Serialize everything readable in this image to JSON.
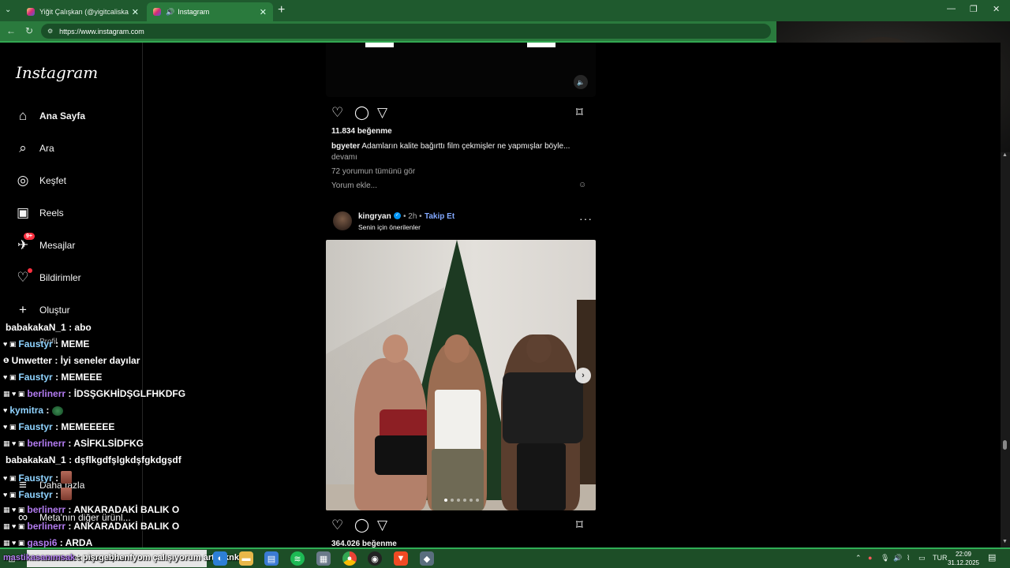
{
  "browser": {
    "tabs": [
      {
        "title": "Yiğit Çalışkan (@yigitcaliskan_) • In"
      },
      {
        "title": "Instagram"
      }
    ],
    "url": "https://www.instagram.com"
  },
  "sidebar": {
    "logo": "Instagram",
    "items": [
      {
        "label": "Ana Sayfa",
        "icon": "home-icon"
      },
      {
        "label": "Ara",
        "icon": "search-icon"
      },
      {
        "label": "Keşfet",
        "icon": "compass-icon"
      },
      {
        "label": "Reels",
        "icon": "reels-icon"
      },
      {
        "label": "Mesajlar",
        "icon": "messenger-icon",
        "badge": "9+"
      },
      {
        "label": "Bildirimler",
        "icon": "heart-icon"
      },
      {
        "label": "Oluştur",
        "icon": "plus-icon"
      },
      {
        "label": "Profil",
        "icon": "avatar-icon"
      },
      {
        "label": "Daha fazla",
        "icon": "menu-icon"
      },
      {
        "label": "Meta'nın diğer ürünl...",
        "icon": "meta-icon"
      }
    ]
  },
  "feed": {
    "post1": {
      "likes": "11.834 beğenme",
      "caption_user": "bgyeter",
      "caption_text": "Adamların kalite bağırttı film çekmişler ne yapmışlar böyle...",
      "more": "devamı",
      "comments_link": "72 yorumun tümünü gör",
      "comment_placeholder": "Yorum ekle..."
    },
    "post2": {
      "username": "kingryan",
      "time": "• 2h •",
      "follow": "Takip Et",
      "subtitle": "Senin için önerilenler",
      "likes": "364.026 beğenme"
    }
  },
  "chat": [
    {
      "user": "babakakaN_1",
      "msg": ": abo",
      "color": "white",
      "badges": ""
    },
    {
      "user": "Faustyr",
      "msg": ": MEME",
      "color": "blue",
      "badges": "♥ ▣"
    },
    {
      "user": "Unwetter",
      "msg": ": İyi seneler dayılar",
      "color": "white",
      "badges": "❶"
    },
    {
      "user": "Faustyr",
      "msg": ": MEMEEE",
      "color": "blue",
      "badges": "♥ ▣"
    },
    {
      "user": "berlinerr",
      "msg": ": İDSŞGKHİDŞGLFHKDFG",
      "color": "purple",
      "badges": "▦ ♥ ▣"
    },
    {
      "user": "kymitra",
      "msg": ":",
      "color": "blue",
      "badges": "♥",
      "emote": "green"
    },
    {
      "user": "Faustyr",
      "msg": ": MEMEEEEE",
      "color": "blue",
      "badges": "♥ ▣"
    },
    {
      "user": "berlinerr",
      "msg": ": ASİFKLSİDFKG",
      "color": "purple",
      "badges": "▦ ♥ ▣"
    },
    {
      "user": "babakakaN_1",
      "msg": ": dşflkgdfşlgkdşfgkdgşdf",
      "color": "white",
      "badges": ""
    },
    {
      "user": "Faustyr",
      "msg": ":",
      "color": "blue",
      "badges": "♥ ▣",
      "emote": "face"
    },
    {
      "user": "Faustyr",
      "msg": ":",
      "color": "blue",
      "badges": "♥ ▣",
      "emote": "face"
    },
    {
      "user": "berlinerr",
      "msg": ": ANKARADAKİ BALIK O",
      "color": "purple",
      "badges": "▦ ♥ ▣"
    },
    {
      "user": "berlinerr",
      "msg": ": ANKARADAKİ BALIK O",
      "color": "purple",
      "badges": "▦ ♥ ▣"
    },
    {
      "user": "gaspi6",
      "msg": ": ARDA",
      "color": "purple",
      "badges": "▦ ♥ ▣"
    },
    {
      "user": "mastikasanımsak",
      "msg": ": pişrgebhenfyom çalışıyorum artık knk",
      "color": "purple",
      "badges": ""
    }
  ],
  "taskbar": {
    "search_placeholder": "Sucihcsek hicsanctjhan",
    "language": "TUR",
    "time": "22:09",
    "date": "31.12.2025"
  }
}
